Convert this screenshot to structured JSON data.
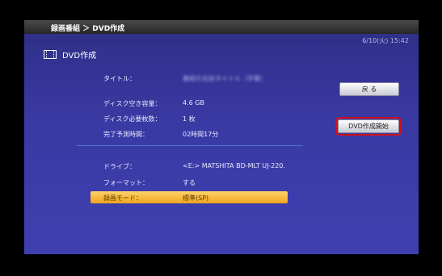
{
  "header": {
    "breadcrumb": "録画番組 ＞ DVD作成",
    "clock": "6/10(火) 15:42"
  },
  "page": {
    "title": "DVD作成",
    "icon": "film-icon"
  },
  "info": [
    {
      "label": "タイトル：",
      "value": "番組の名前タイトル（字幕）"
    },
    {
      "label": "ディスク空き容量：",
      "value": "4.6 GB"
    },
    {
      "label": "ディスク必要枚数：",
      "value": "1 枚"
    },
    {
      "label": "完了予測時間：",
      "value": "02時間17分"
    }
  ],
  "settings": [
    {
      "label": "ドライブ：",
      "value": "<E:> MATSHITA BD-MLT UJ-220."
    },
    {
      "label": "フォーマット：",
      "value": "する"
    },
    {
      "label": "録画モード：",
      "value": "標準(SP)"
    }
  ],
  "buttons": {
    "back": "戻 る",
    "start": "DVD作成開始"
  },
  "colors": {
    "highlight": "#f5b42a",
    "focus_outline": "#d0101c",
    "background": "#3a3aa4"
  }
}
